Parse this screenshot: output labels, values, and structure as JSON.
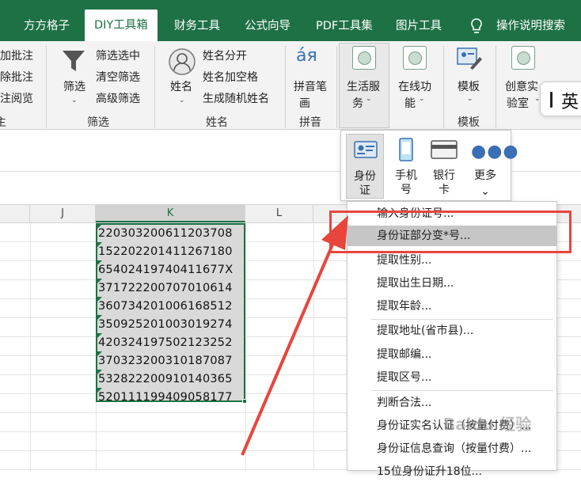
{
  "tabs": [
    {
      "label": "方方格子"
    },
    {
      "label": "DIY工具箱"
    },
    {
      "label": "财务工具"
    },
    {
      "label": "公式向导"
    },
    {
      "label": "PDF工具集"
    },
    {
      "label": "图片工具"
    },
    {
      "label": "操作说明搜索"
    }
  ],
  "ribbon": {
    "comment": {
      "items": [
        "加批注",
        "除批注",
        "注阅览"
      ],
      "group": "主"
    },
    "filter": {
      "big": "筛选",
      "items": [
        "筛选选中",
        "清空筛选",
        "高级筛选"
      ],
      "group": "筛选"
    },
    "name": {
      "big": "姓名",
      "items": [
        "姓名分开",
        "姓名加空格",
        "生成随机姓名"
      ],
      "group": "姓名"
    },
    "pinyin": {
      "big1": "拼音笔",
      "big2": "画",
      "group": "拼音"
    },
    "life": {
      "label1": "生活服",
      "label2": "务"
    },
    "online": {
      "label1": "在线功",
      "label2": "能"
    },
    "template": {
      "label": "模板",
      "group": "模板"
    },
    "creative": {
      "label1": "创意实",
      "label2": "验室"
    },
    "ime": "英"
  },
  "popup": {
    "items": [
      {
        "label1": "身份",
        "label2": "证"
      },
      {
        "label1": "手机",
        "label2": "号"
      },
      {
        "label1": "银行",
        "label2": "卡"
      },
      {
        "label1": "更多",
        "label2": ""
      }
    ]
  },
  "columns": {
    "j": "J",
    "k": "K",
    "l": "L"
  },
  "cells": [
    "220303200611203708",
    "152202201411267180",
    "65402419740411677X",
    "371722200707010614",
    "360734201006168512",
    "350925201003019274",
    "420324197502123252",
    "370323200310187087",
    "532822200910140365",
    "520111199409058177"
  ],
  "menu": {
    "items": [
      "输入身份证号...",
      "身份证部分变*号...",
      "提取性别...",
      "提取出生日期...",
      "提取年龄...",
      "提取地址(省市县)...",
      "提取邮编...",
      "提取区号...",
      "判断合法...",
      "身份证实名认证（按量付费）...",
      "身份证信息查询（按量付费）...",
      "15位身份证升18位..."
    ]
  },
  "watermark": "Baidu 经验",
  "colors": {
    "accent": "#1e7145",
    "annotation": "#e8453c"
  }
}
